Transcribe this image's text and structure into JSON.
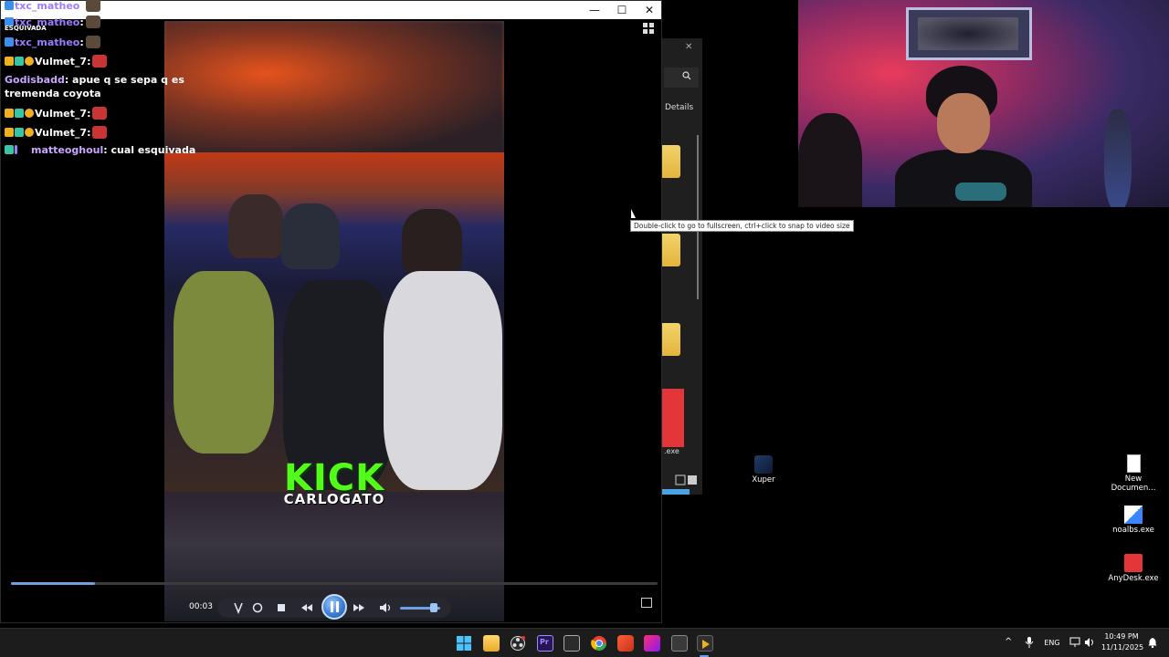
{
  "player": {
    "window_controls": {
      "minimize": "—",
      "maximize": "☐",
      "close": "✕"
    },
    "video_overlay": {
      "kick_logo": "KICK",
      "streamer_tag": "CARLOGATO"
    },
    "timecode": "00:03",
    "progress_fraction": 0.13,
    "volume_fraction": 0.85
  },
  "chat": {
    "messages": [
      {
        "user": "txc_matheo",
        "user_color": "#9d7cff",
        "text": ":",
        "emote": "face-emote"
      },
      {
        "user": "ESQUIVADA",
        "user_color": "#ffffff",
        "text": "",
        "emote": ""
      },
      {
        "user": "txc_matheo",
        "user_color": "#9d7cff",
        "text": ":",
        "emote": "face-emote"
      },
      {
        "user": "Vulmet_7",
        "user_color": "#ffffff",
        "text": ":",
        "emote": "red-emote"
      },
      {
        "user": "Godisbadd",
        "user_color": "#c9a6ff",
        "text": ": apue q se sepa q es",
        "emote": ""
      },
      {
        "user": "",
        "user_color": "#ffffff",
        "text": "tremenda coyota",
        "emote": ""
      },
      {
        "user": "Vulmet_7",
        "user_color": "#ffffff",
        "text": ":",
        "emote": "red-emote"
      },
      {
        "user": "Vulmet_7",
        "user_color": "#ffffff",
        "text": ":",
        "emote": "red-emote"
      },
      {
        "user": "matteoghoul",
        "user_color": "#c9a6ff",
        "text": ": cual esquivada",
        "emote": ""
      }
    ]
  },
  "tooltip": {
    "text": "Double-click to go to fullscreen, ctrl+click to snap to video size"
  },
  "explorer": {
    "details_label": "Details",
    "close_glyph": "✕",
    "search_glyph": "🔍",
    "exe_label": ".exe"
  },
  "desktop_icons": [
    {
      "label": "Xuper"
    },
    {
      "label": "New Documen..."
    },
    {
      "label": "noalbs.exe"
    },
    {
      "label": "AnyDesk.exe"
    }
  ],
  "taskbar": {
    "language": "ENG",
    "time": "10:49 PM",
    "date": "11/11/2025",
    "tray_up_glyph": "^"
  },
  "colors": {
    "kick_green": "#53fc18",
    "taskbar_bg": "#1c1c1c",
    "accent_blue": "#6aa0e8"
  }
}
